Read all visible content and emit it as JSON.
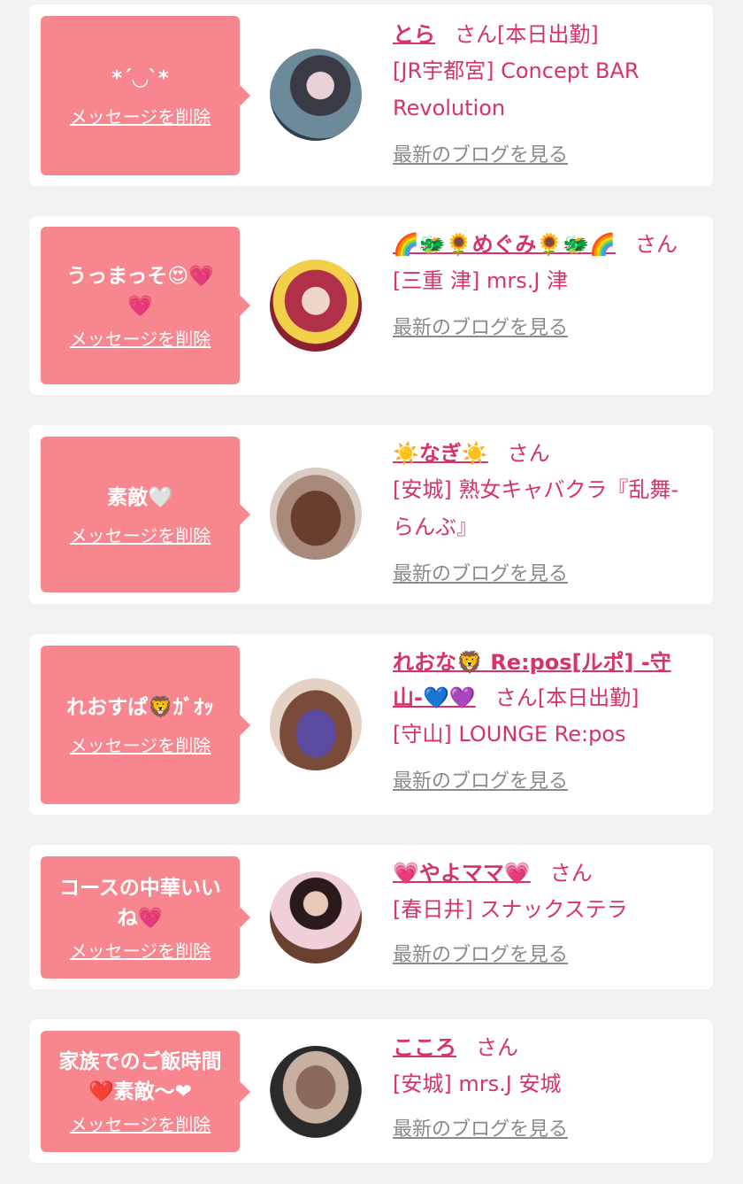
{
  "colors": {
    "accent": "#d6336a",
    "bubble": "#f7868f",
    "link_gray": "#8a8a8a",
    "background": "#f2f2f2"
  },
  "messages": [
    {
      "message": "*´◡`*",
      "delete_label": "メッセージを削除",
      "name": "とら",
      "honorific": "さん",
      "status": "[本日出勤]",
      "shop": "[JR宇都宮] Concept BAR Revolution",
      "blog_link": "最新のブログを見る"
    },
    {
      "message": "うっまっそ😍💗💗",
      "delete_label": "メッセージを削除",
      "name": "🌈🐲🌻めぐみ🌻🐲🌈",
      "honorific": "さん",
      "status": "",
      "shop": "[三重 津] mrs.J 津",
      "blog_link": "最新のブログを見る"
    },
    {
      "message": "素敵🤍",
      "delete_label": "メッセージを削除",
      "name": "☀️なぎ☀️",
      "honorific": "さん",
      "status": "",
      "shop": "[安城] 熟女キャバクラ『乱舞-らんぶ』",
      "blog_link": "最新のブログを見る"
    },
    {
      "message": "れおすぱ🦁ｶﾞｵｯ",
      "delete_label": "メッセージを削除",
      "name": "れおな🦁 Re:pos[ルポ] -守山-💙💜",
      "honorific": "さん",
      "status": "[本日出勤]",
      "shop": "[守山] LOUNGE Re:pos",
      "blog_link": "最新のブログを見る"
    },
    {
      "message": "コースの中華いいね💗",
      "delete_label": "メッセージを削除",
      "name": "💗やよママ💗",
      "honorific": "さん",
      "status": "",
      "shop": "[春日井] スナックステラ",
      "blog_link": "最新のブログを見る"
    },
    {
      "message": "家族でのご飯時間❤️素敵〜❤",
      "delete_label": "メッセージを削除",
      "name": "こころ",
      "honorific": "さん",
      "status": "",
      "shop": "[安城] mrs.J 安城",
      "blog_link": "最新のブログを見る"
    }
  ]
}
